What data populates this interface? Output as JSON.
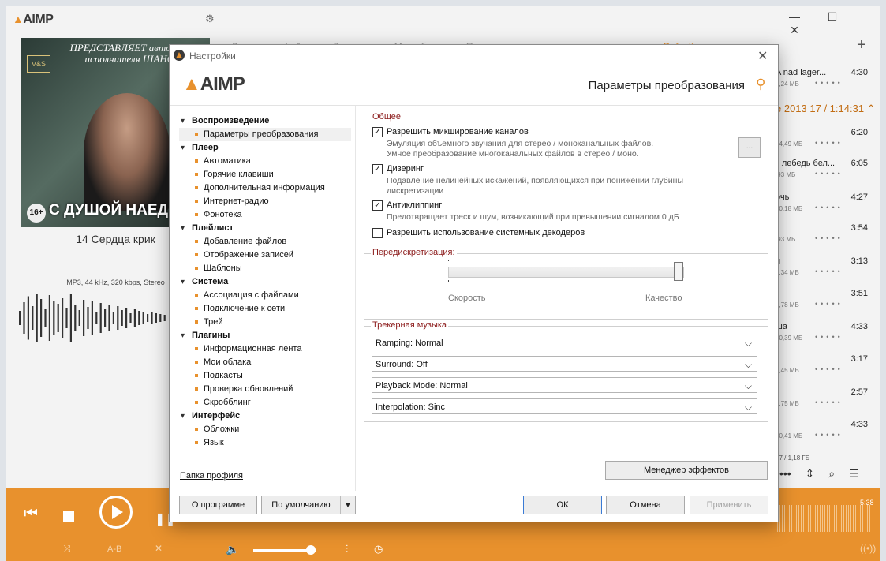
{
  "player": {
    "logo": "AIMP",
    "track_title": "14 Сердца крик",
    "track_info": "MP3, 44 kHz, 320 kbps, Stereo",
    "cover": {
      "top_text": "ПРЕДСТАВЛЯЕТ автора и исполнителя ШАНС",
      "badge": "V&S",
      "age": "16+",
      "bottom_text": "С ДУШОЙ НАЕД"
    },
    "tabs": [
      "Локальные файлы",
      "Закладки",
      "Мои облака",
      "Подкасты"
    ],
    "playlist_name": "Default",
    "group_header": "е 2013  17 / 1:14:31",
    "tracks": [
      {
        "name": "A nad lager...",
        "duration": "4:30",
        "size": "3,24 МБ"
      },
      {
        "name": "",
        "duration": "6:20",
        "size": "14,49 МБ"
      },
      {
        "name": "к лебедь бел...",
        "duration": "6:05",
        "size": ",93 МБ"
      },
      {
        "name": "очь",
        "duration": "4:27",
        "size": "10,18 МБ"
      },
      {
        "name": "",
        "duration": "3:54",
        "size": ",93 МБ"
      },
      {
        "name": "и",
        "duration": "3:13",
        "size": "7,34 МБ"
      },
      {
        "name": "",
        "duration": "3:51",
        "size": "8,78 МБ"
      },
      {
        "name": "ша",
        "duration": "4:33",
        "size": "10,39 МБ"
      },
      {
        "name": "",
        "duration": "3:17",
        "size": "7,45 МБ"
      },
      {
        "name": "",
        "duration": "2:57",
        "size": "6,75 МБ"
      },
      {
        "name": "",
        "duration": "4:33",
        "size": "10,41 МБ"
      }
    ],
    "playlist_total": "17 / 1,18 ГБ",
    "time_total": "5:38",
    "ab_label": "A-B"
  },
  "dialog": {
    "title": "Настройки",
    "logo": "AIMP",
    "page_title": "Параметры преобразования",
    "tree": [
      {
        "label": "Воспроизведение",
        "items": [
          {
            "label": "Параметры преобразования"
          }
        ]
      },
      {
        "label": "Плеер",
        "items": [
          {
            "label": "Автоматика"
          },
          {
            "label": "Горячие клавиши"
          },
          {
            "label": "Дополнительная информация"
          },
          {
            "label": "Интернет-радио"
          },
          {
            "label": "Фонотека"
          }
        ]
      },
      {
        "label": "Плейлист",
        "items": [
          {
            "label": "Добавление файлов"
          },
          {
            "label": "Отображение записей"
          },
          {
            "label": "Шаблоны"
          }
        ]
      },
      {
        "label": "Система",
        "items": [
          {
            "label": "Ассоциация с файлами"
          },
          {
            "label": "Подключение к сети"
          },
          {
            "label": "Трей"
          }
        ]
      },
      {
        "label": "Плагины",
        "items": [
          {
            "label": "Информационная лента"
          },
          {
            "label": "Мои облака"
          },
          {
            "label": "Подкасты"
          },
          {
            "label": "Проверка обновлений"
          },
          {
            "label": "Скробблинг"
          }
        ]
      },
      {
        "label": "Интерфейс",
        "items": [
          {
            "label": "Обложки"
          },
          {
            "label": "Язык"
          }
        ]
      }
    ],
    "profile_link": "Папка профиля",
    "general": {
      "label": "Общее",
      "mixing": {
        "label": "Разрешить микширование каналов",
        "checked": true,
        "desc": "Эмуляция объемного звучания для стерео / моноканальных файлов.\nУмное преобразование многоканальных файлов в стерео / моно."
      },
      "more_button": "...",
      "dithering": {
        "label": "Дизеринг",
        "checked": true,
        "desc": "Подавление нелинейных искажений, появляющихся при понижении глубины дискретизации"
      },
      "anticlipping": {
        "label": "Антиклиппинг",
        "checked": true,
        "desc": "Предотвращает треск и шум, возникающий при превышении сигналом 0 дБ"
      },
      "system_decoders": {
        "label": "Разрешить использование системных декодеров",
        "checked": false
      }
    },
    "resampling": {
      "label": "Передискретизация:",
      "left_caption": "Скорость",
      "right_caption": "Качество",
      "value": 1.0
    },
    "tracker": {
      "label": "Трекерная музыка",
      "ramping": "Ramping: Normal",
      "surround": "Surround: Off",
      "playback_mode": "Playback Mode: Normal",
      "interpolation": "Interpolation: Sinc"
    },
    "buttons": {
      "effects_manager": "Менеджер эффектов",
      "about": "О программе",
      "defaults": "По умолчанию",
      "ok": "ОК",
      "cancel": "Отмена",
      "apply": "Применить"
    }
  },
  "colors": {
    "accent": "#e8912d",
    "group_label": "#8b1a1a"
  }
}
